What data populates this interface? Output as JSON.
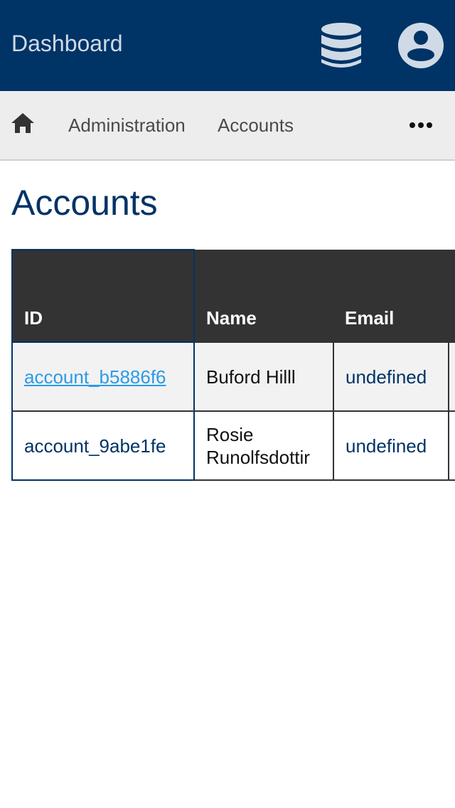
{
  "app": {
    "title": "Dashboard",
    "icons": [
      "database-icon",
      "account-circle-icon"
    ]
  },
  "breadcrumb": {
    "home_icon": "home-icon",
    "items": [
      "Administration",
      "Accounts"
    ],
    "more_icon": "more-horizontal-icon"
  },
  "page": {
    "title": "Accounts"
  },
  "table": {
    "columns": [
      "ID",
      "Name",
      "Email",
      ""
    ],
    "rows": [
      {
        "id": "account_b5886f6",
        "name": "Buford Hilll",
        "email": "undefined",
        "id_is_link": true
      },
      {
        "id": "account_9abe1fe",
        "name": "Rosie Runolfsdottir",
        "email": "undefined",
        "id_is_link": false
      }
    ]
  },
  "colors": {
    "primary": "#003366",
    "header_text": "#cfdae6",
    "table_header_bg": "#333333",
    "link": "#2b9be8",
    "breadcrumb_bg": "#ededed"
  }
}
